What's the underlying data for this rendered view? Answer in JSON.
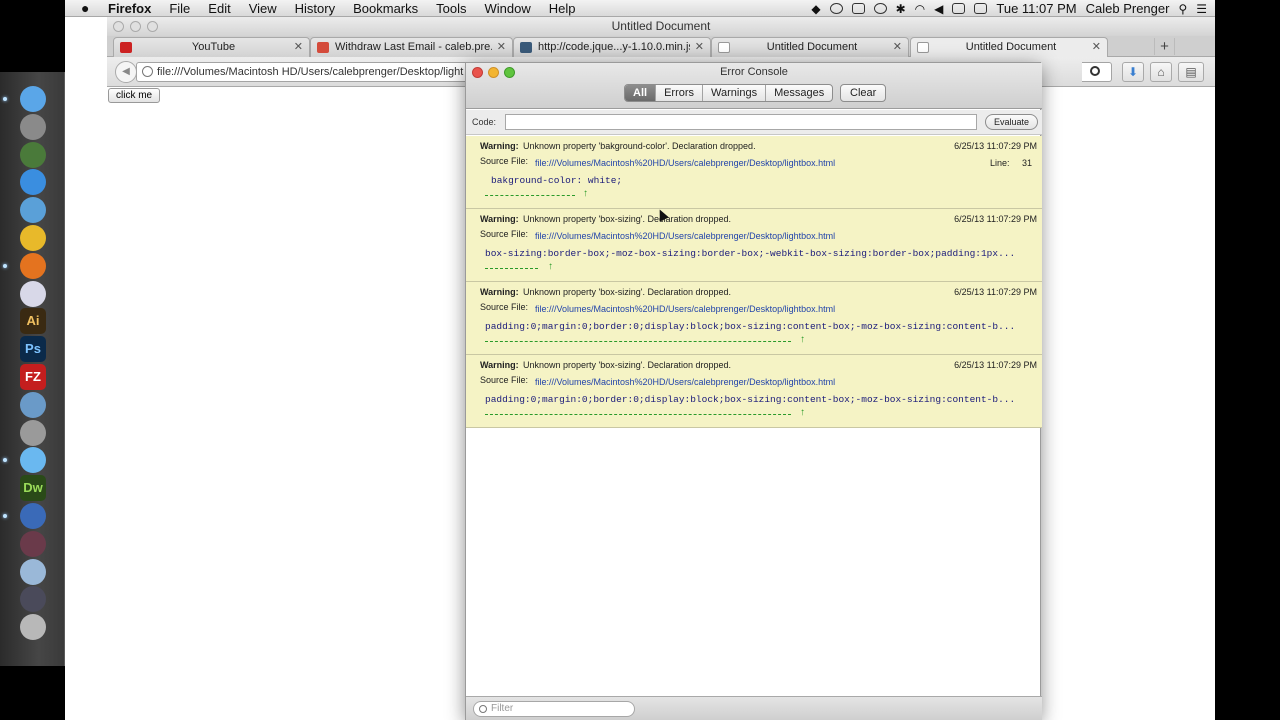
{
  "menubar": {
    "apple_icon": "apple-logo",
    "app_name": "Firefox",
    "items": [
      "File",
      "Edit",
      "View",
      "History",
      "Bookmarks",
      "Tools",
      "Window",
      "Help"
    ],
    "clock": "Tue 11:07 PM",
    "user": "Caleb Prenger"
  },
  "window": {
    "title": "Untitled Document"
  },
  "tabs": [
    {
      "title": "YouTube",
      "favicon_color": "#cc2222"
    },
    {
      "title": "Withdraw Last Email - caleb.pre...",
      "favicon_color": "#d44b3b"
    },
    {
      "title": "http://code.jque...y-1.10.0.min.js",
      "favicon_color": "#3a5a7a"
    },
    {
      "title": "Untitled Document",
      "favicon_color": "#ffffff"
    },
    {
      "title": "Untitled Document",
      "favicon_color": "#ffffff"
    }
  ],
  "toolbar": {
    "url": "file:///Volumes/Macintosh HD/Users/calebprenger/Desktop/light"
  },
  "content": {
    "button_label": "click me"
  },
  "console": {
    "title": "Error Console",
    "filters": [
      "All",
      "Errors",
      "Warnings",
      "Messages"
    ],
    "active_filter": "All",
    "clear_label": "Clear",
    "code_label": "Code:",
    "code_value": "",
    "evaluate_label": "Evaluate",
    "filter_placeholder": "Filter",
    "entries": [
      {
        "type": "Warning:",
        "message": "Unknown property 'bakground-color'.  Declaration dropped.",
        "time": "6/25/13 11:07:29 PM",
        "source_label": "Source File:",
        "source": "file:///Volumes/Macintosh%20HD/Users/calebprenger/Desktop/lightbox.html",
        "line_label": "Line:",
        "line": "31",
        "code": "bakground-color: white;"
      },
      {
        "type": "Warning:",
        "message": "Unknown property 'box-sizing'.  Declaration dropped.",
        "time": "6/25/13 11:07:29 PM",
        "source_label": "Source File:",
        "source": "file:///Volumes/Macintosh%20HD/Users/calebprenger/Desktop/lightbox.html",
        "line_label": "",
        "line": "",
        "code": "box-sizing:border-box;-moz-box-sizing:border-box;-webkit-box-sizing:border-box;padding:1px..."
      },
      {
        "type": "Warning:",
        "message": "Unknown property 'box-sizing'.  Declaration dropped.",
        "time": "6/25/13 11:07:29 PM",
        "source_label": "Source File:",
        "source": "file:///Volumes/Macintosh%20HD/Users/calebprenger/Desktop/lightbox.html",
        "line_label": "",
        "line": "",
        "code": "padding:0;margin:0;border:0;display:block;box-sizing:content-box;-moz-box-sizing:content-b..."
      },
      {
        "type": "Warning:",
        "message": "Unknown property 'box-sizing'.  Declaration dropped.",
        "time": "6/25/13 11:07:29 PM",
        "source_label": "Source File:",
        "source": "file:///Volumes/Macintosh%20HD/Users/calebprenger/Desktop/lightbox.html",
        "line_label": "",
        "line": "",
        "code": "padding:0;margin:0;border:0;display:block;box-sizing:content-box;-moz-box-sizing:content-b..."
      }
    ]
  },
  "dock": {
    "apps": [
      {
        "name": "finder-icon",
        "color": "#5aa6e8"
      },
      {
        "name": "launchpad-icon",
        "color": "#8a8a8a"
      },
      {
        "name": "mission-control-icon",
        "color": "#4a7a3a"
      },
      {
        "name": "app-store-icon",
        "color": "#3a8ee0"
      },
      {
        "name": "safari-icon",
        "color": "#5aa0d8"
      },
      {
        "name": "chrome-icon",
        "color": "#e8b92a"
      },
      {
        "name": "firefox-icon",
        "color": "#e4731f"
      },
      {
        "name": "itunes-icon",
        "color": "#d8d8e8"
      },
      {
        "name": "illustrator-icon",
        "color": "#3a2a12"
      },
      {
        "name": "photoshop-icon",
        "color": "#0b2a4a"
      },
      {
        "name": "filezilla-icon",
        "color": "#c41e1e"
      },
      {
        "name": "xcode-icon",
        "color": "#6a9ac8"
      },
      {
        "name": "system-preferences-icon",
        "color": "#9a9a9a"
      },
      {
        "name": "messages-icon",
        "color": "#6ab8f0"
      },
      {
        "name": "dreamweaver-icon",
        "color": "#2a4a18"
      },
      {
        "name": "quicktime-icon",
        "color": "#3a6ab8"
      },
      {
        "name": "document-icon",
        "color": "#6a3a4a"
      },
      {
        "name": "folder-icon",
        "color": "#9ab8d8"
      },
      {
        "name": "downloads-icon",
        "color": "#4a4a5a"
      },
      {
        "name": "trash-icon",
        "color": "#b8b8b8"
      }
    ],
    "labels": {
      "illustrator-icon": "Ai",
      "photoshop-icon": "Ps",
      "filezilla-icon": "FZ",
      "dreamweaver-icon": "Dw"
    },
    "running": [
      "finder-icon",
      "firefox-icon",
      "messages-icon",
      "quicktime-icon"
    ]
  }
}
